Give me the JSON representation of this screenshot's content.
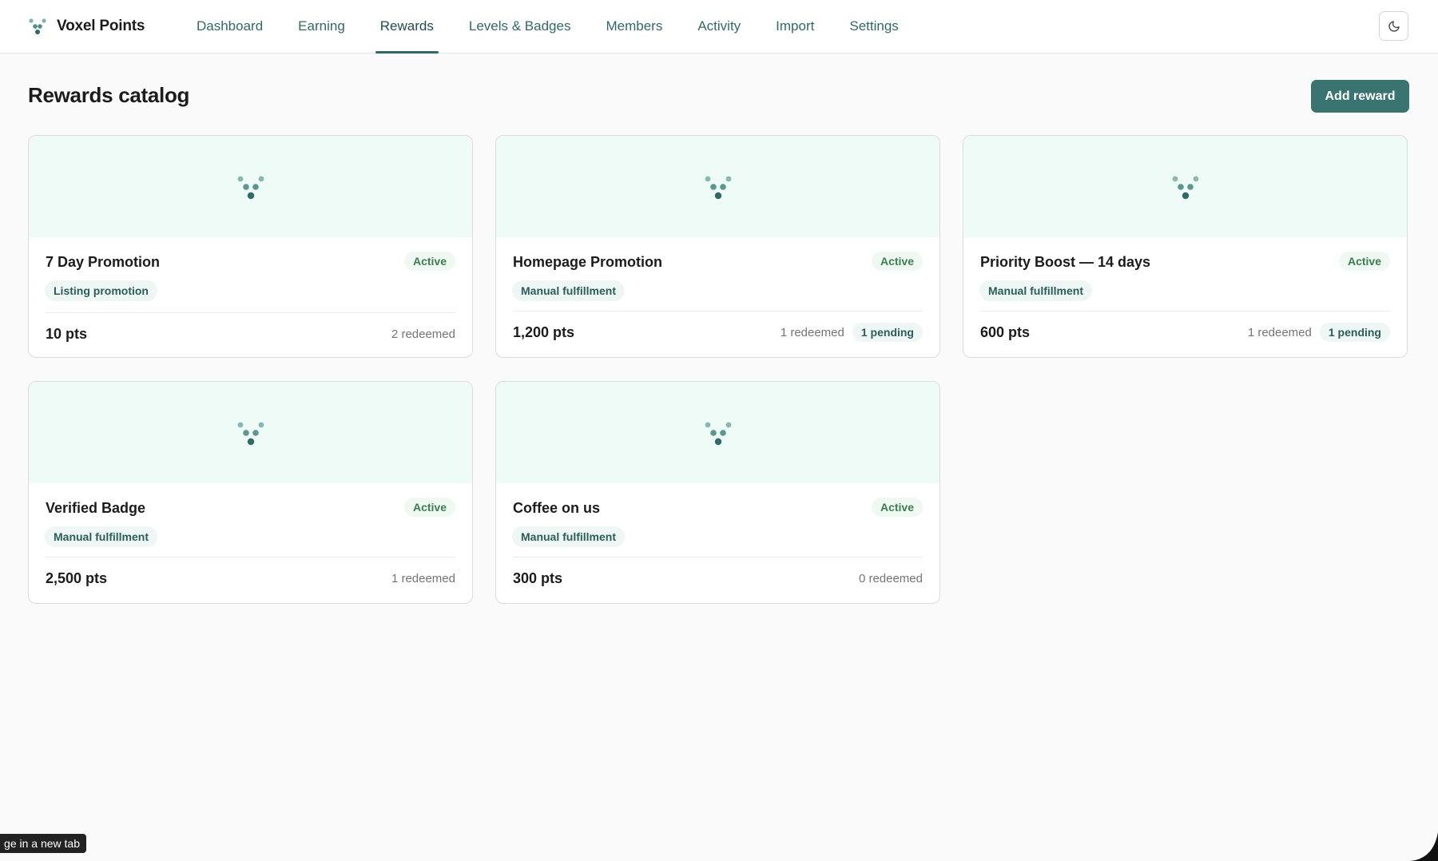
{
  "app": {
    "name": "Voxel Points",
    "logo_icon": "voxel-dots-icon",
    "accent": "#2f6b66"
  },
  "nav": {
    "tabs": [
      {
        "label": "Dashboard",
        "active": false
      },
      {
        "label": "Earning",
        "active": false
      },
      {
        "label": "Rewards",
        "active": true
      },
      {
        "label": "Levels & Badges",
        "active": false
      },
      {
        "label": "Members",
        "active": false
      },
      {
        "label": "Activity",
        "active": false
      },
      {
        "label": "Import",
        "active": false
      },
      {
        "label": "Settings",
        "active": false
      }
    ],
    "theme_toggle_icon": "moon-icon"
  },
  "page": {
    "title": "Rewards catalog",
    "add_button_label": "Add reward"
  },
  "rewards": [
    {
      "title": "7 Day Promotion",
      "status": "Active",
      "type": "Listing promotion",
      "points": "10 pts",
      "redeemed": "2 redeemed",
      "pending": ""
    },
    {
      "title": "Homepage Promotion",
      "status": "Active",
      "type": "Manual fulfillment",
      "points": "1,200 pts",
      "redeemed": "1 redeemed",
      "pending": "1 pending"
    },
    {
      "title": "Priority Boost — 14 days",
      "status": "Active",
      "type": "Manual fulfillment",
      "points": "600 pts",
      "redeemed": "1 redeemed",
      "pending": "1 pending"
    },
    {
      "title": "Verified Badge",
      "status": "Active",
      "type": "Manual fulfillment",
      "points": "2,500 pts",
      "redeemed": "1 redeemed",
      "pending": ""
    },
    {
      "title": "Coffee on us",
      "status": "Active",
      "type": "Manual fulfillment",
      "points": "300 pts",
      "redeemed": "0 redeemed",
      "pending": ""
    }
  ],
  "tooltip": {
    "text": "ge in a new tab"
  }
}
